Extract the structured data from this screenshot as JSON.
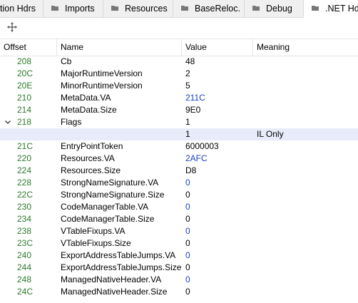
{
  "tabs": [
    {
      "label": "tion Hdrs"
    },
    {
      "label": "Imports"
    },
    {
      "label": "Resources"
    },
    {
      "label": "BaseReloc."
    },
    {
      "label": "Debug"
    },
    {
      "label": ".NET Hdr"
    }
  ],
  "columns": [
    "Offset",
    "Name",
    "Value",
    "Meaning"
  ],
  "rows": [
    {
      "offset": "208",
      "name": "Cb",
      "value": "48",
      "meaning": ""
    },
    {
      "offset": "20C",
      "name": "MajorRuntimeVersion",
      "value": "2",
      "meaning": ""
    },
    {
      "offset": "20E",
      "name": "MinorRuntimeVersion",
      "value": "5",
      "meaning": ""
    },
    {
      "offset": "210",
      "name": "MetaData.VA",
      "value": "211C",
      "meaning": ""
    },
    {
      "offset": "214",
      "name": "MetaData.Size",
      "value": "9E0",
      "meaning": ""
    },
    {
      "offset": "218",
      "name": "Flags",
      "value": "1",
      "meaning": ""
    },
    {
      "offset": "",
      "name": "",
      "value": "1",
      "meaning": "IL Only"
    },
    {
      "offset": "21C",
      "name": "EntryPointToken",
      "value": "6000003",
      "meaning": ""
    },
    {
      "offset": "220",
      "name": "Resources.VA",
      "value": "2AFC",
      "meaning": ""
    },
    {
      "offset": "224",
      "name": "Resources.Size",
      "value": "D8",
      "meaning": ""
    },
    {
      "offset": "228",
      "name": "StrongNameSignature.VA",
      "value": "0",
      "meaning": ""
    },
    {
      "offset": "22C",
      "name": "StrongNameSignature.Size",
      "value": "0",
      "meaning": ""
    },
    {
      "offset": "230",
      "name": "CodeManagerTable.VA",
      "value": "0",
      "meaning": ""
    },
    {
      "offset": "234",
      "name": "CodeManagerTable.Size",
      "value": "0",
      "meaning": ""
    },
    {
      "offset": "238",
      "name": "VTableFixups.VA",
      "value": "0",
      "meaning": ""
    },
    {
      "offset": "23C",
      "name": "VTableFixups.Size",
      "value": "0",
      "meaning": ""
    },
    {
      "offset": "240",
      "name": "ExportAddressTableJumps.VA",
      "value": "0",
      "meaning": ""
    },
    {
      "offset": "244",
      "name": "ExportAddressTableJumps.Size",
      "value": "0",
      "meaning": ""
    },
    {
      "offset": "248",
      "name": "ManagedNativeHeader.VA",
      "value": "0",
      "meaning": ""
    },
    {
      "offset": "24C",
      "name": "ManagedNativeHeader.Size",
      "value": "0",
      "meaning": ""
    }
  ],
  "colors": {
    "offset": "#2a7a2a",
    "address_value": "#1a3fc0",
    "selected_row": "#e8ecfa"
  }
}
